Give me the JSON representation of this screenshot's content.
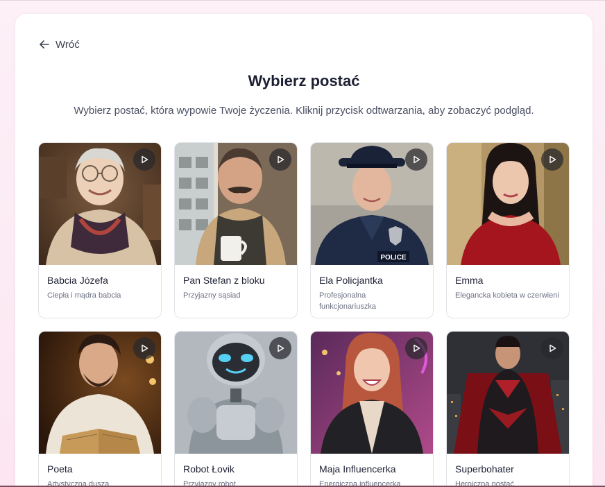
{
  "header": {
    "back_label": "Wróć",
    "title": "Wybierz postać",
    "subtitle": "Wybierz postać, która wypowie Twoje życzenia. Kliknij przycisk odtwarzania, aby zobaczyć podgląd."
  },
  "characters": [
    {
      "name": "Babcia Józefa",
      "description": "Ciepła i mądra babcia"
    },
    {
      "name": "Pan Stefan z bloku",
      "description": "Przyjazny sąsiad"
    },
    {
      "name": "Ela Policjantka",
      "description": "Profesjonalna funkcjonariuszka"
    },
    {
      "name": "Emma",
      "description": "Elegancka kobieta w czerwieni"
    },
    {
      "name": "Poeta",
      "description": "Artystyczna dusza"
    },
    {
      "name": "Robot Łovik",
      "description": "Przyjazny robot"
    },
    {
      "name": "Maja Influencerka",
      "description": "Energiczna influencerka"
    },
    {
      "name": "Superbohater",
      "description": "Heroiczna postać"
    }
  ],
  "badges": {
    "police_badge": "POLICE"
  },
  "icons": {
    "back": "arrow-left-icon",
    "play": "play-icon"
  }
}
